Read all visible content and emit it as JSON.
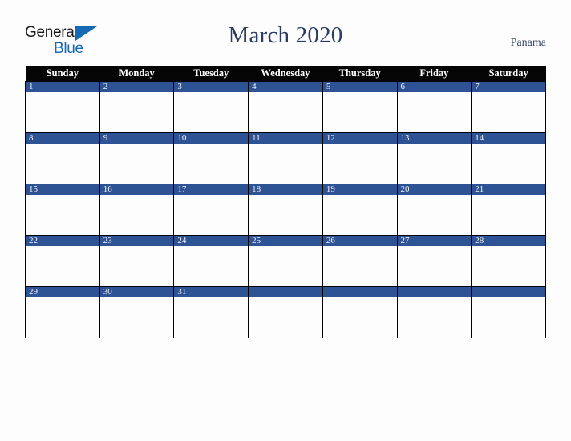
{
  "brand": {
    "name_top": "General",
    "name_bottom": "Blue",
    "triangle_color": "#1569b5"
  },
  "header": {
    "title": "March 2020",
    "region": "Panama",
    "title_color": "#2b3c62",
    "region_color": "#3b4a6b"
  },
  "calendar": {
    "header_bg": "#050505",
    "daynum_bg": "#2e5394",
    "cell_bg": "#fdfdfd",
    "weekday_headers": [
      "Sunday",
      "Monday",
      "Tuesday",
      "Wednesday",
      "Thursday",
      "Friday",
      "Saturday"
    ],
    "weeks": [
      [
        "1",
        "2",
        "3",
        "4",
        "5",
        "6",
        "7"
      ],
      [
        "8",
        "9",
        "10",
        "11",
        "12",
        "13",
        "14"
      ],
      [
        "15",
        "16",
        "17",
        "18",
        "19",
        "20",
        "21"
      ],
      [
        "22",
        "23",
        "24",
        "25",
        "26",
        "27",
        "28"
      ],
      [
        "29",
        "30",
        "31",
        "",
        "",
        "",
        ""
      ]
    ]
  }
}
